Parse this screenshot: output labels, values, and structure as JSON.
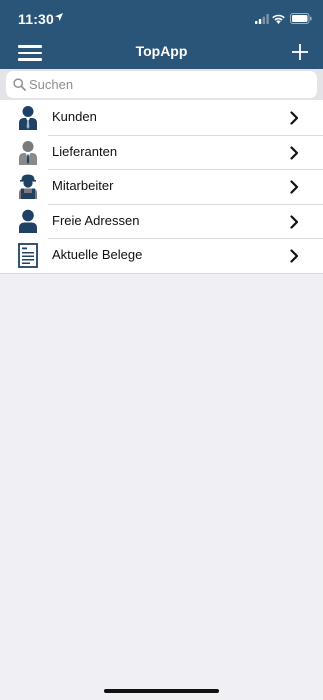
{
  "status_bar": {
    "time": "11:30"
  },
  "nav": {
    "title": "TopApp",
    "menu_icon": "hamburger-menu-icon",
    "add_icon": "plus-icon"
  },
  "search": {
    "placeholder": "Suchen",
    "value": ""
  },
  "menu_items": [
    {
      "label": "Kunden",
      "icon": "customer-person-icon"
    },
    {
      "label": "Lieferanten",
      "icon": "supplier-person-icon"
    },
    {
      "label": "Mitarbeiter",
      "icon": "worker-person-icon"
    },
    {
      "label": "Freie Adressen",
      "icon": "person-icon"
    },
    {
      "label": "Aktuelle Belege",
      "icon": "document-icon"
    }
  ],
  "colors": {
    "header": "#2b5578",
    "background": "#efeff4",
    "icon_blue": "#1f4264"
  }
}
